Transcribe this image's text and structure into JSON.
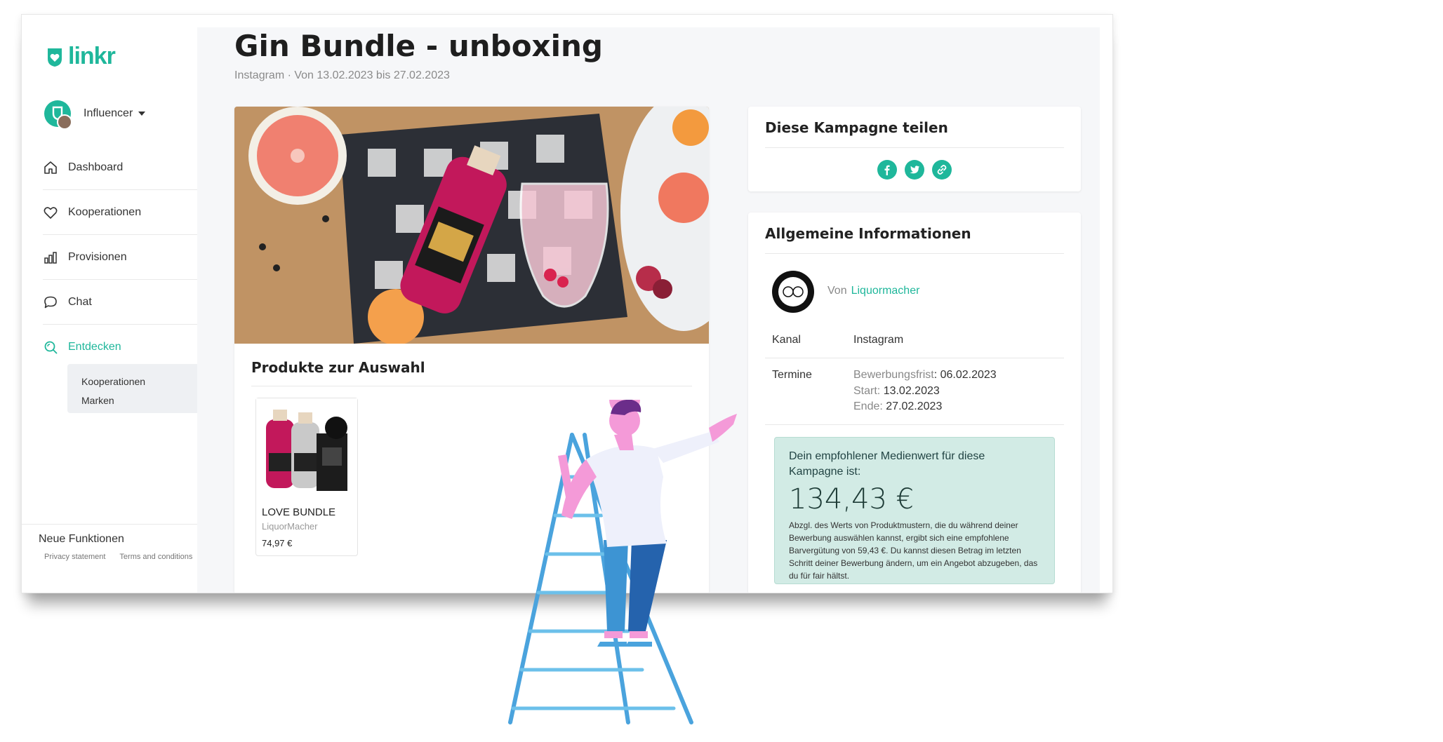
{
  "app": {
    "logo_text": "linkr",
    "role": "Influencer"
  },
  "nav": {
    "items": [
      {
        "label": "Dashboard",
        "icon": "home-icon"
      },
      {
        "label": "Kooperationen",
        "icon": "heart-icon"
      },
      {
        "label": "Provisionen",
        "icon": "bar-chart-icon"
      },
      {
        "label": "Chat",
        "icon": "chat-icon"
      },
      {
        "label": "Entdecken",
        "icon": "discover-icon"
      }
    ],
    "sub_items": [
      "Kooperationen",
      "Marken"
    ]
  },
  "footer": {
    "new_features": "Neue Funktionen",
    "privacy": "Privacy statement",
    "terms": "Terms and conditions"
  },
  "campaign": {
    "title": "Gin Bundle - unboxing",
    "subtitle": "Instagram · Von 13.02.2023 bis 27.02.2023"
  },
  "products": {
    "heading": "Produkte zur Auswahl",
    "items": [
      {
        "name": "LOVE BUNDLE",
        "brand": "LiquorMacher",
        "price": "74,97 €"
      }
    ]
  },
  "share": {
    "heading": "Diese Kampagne teilen",
    "icons": [
      "facebook-icon",
      "twitter-icon",
      "link-icon"
    ]
  },
  "info": {
    "heading": "Allgemeine Informationen",
    "by_label": "Von",
    "brand": "Liquormacher",
    "channel_label": "Kanal",
    "channel_value": "Instagram",
    "dates_label": "Termine",
    "deadline_label": "Bewerbungsfrist",
    "deadline_value": "06.02.2023",
    "start_label": "Start:",
    "start_value": "13.02.2023",
    "end_label": "Ende:",
    "end_value": "27.02.2023"
  },
  "recommendation": {
    "heading": "Dein empfohlener Medienwert für diese Kampagne ist:",
    "value": "134,43 €",
    "text": "Abzgl. des Werts von Produktmustern, die du während deiner Bewerbung auswählen kannst, ergibt sich eine empfohlene Barvergütung von 59,43 €. Du kannst diesen Betrag im letzten Schritt deiner Bewerbung ändern, um ein Angebot abzugeben, das du für fair hältst."
  },
  "colors": {
    "accent": "#1fb79b",
    "recommendation_bg": "#d2ebe5"
  }
}
